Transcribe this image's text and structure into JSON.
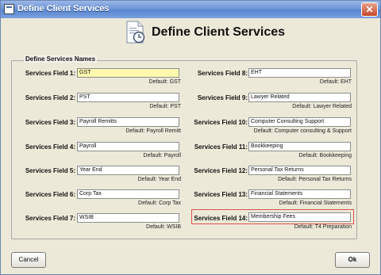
{
  "window": {
    "title": "Define Client Services",
    "close_glyph": "✕"
  },
  "header": {
    "title": "Define Client Services",
    "icon": "document-clock-icon"
  },
  "group": {
    "label": "Define Services Names"
  },
  "fields": [
    {
      "label": "Services Field 1:",
      "value": "GST",
      "default": "Default: GST"
    },
    {
      "label": "Services Field 2:",
      "value": "PST",
      "default": "Default: PST"
    },
    {
      "label": "Services Field 3:",
      "value": "Payroll Remitts",
      "default": "Default: Payroll Remitt"
    },
    {
      "label": "Services Field 4:",
      "value": "Payroll",
      "default": "Default: Payroll"
    },
    {
      "label": "Services Field 5:",
      "value": "Year End",
      "default": "Default: Year End"
    },
    {
      "label": "Services Field 6:",
      "value": "Corp Tax",
      "default": "Default: Corp Tax"
    },
    {
      "label": "Services Field 7:",
      "value": "WSIB",
      "default": "Default: WSIB"
    },
    {
      "label": "Services Field 8:",
      "value": "EHT",
      "default": "Default: EHT"
    },
    {
      "label": "Services Field 9:",
      "value": "Lawyer Related",
      "default": "Default: Lawyer Related"
    },
    {
      "label": "Services Field 10:",
      "value": "Computer Consulting Support",
      "default": "Default: Computer consulting & Support"
    },
    {
      "label": "Services Field 11:",
      "value": "Bookkeeping",
      "default": "Default: Bookkeeping"
    },
    {
      "label": "Services Field 12:",
      "value": "Personal Tax Returns",
      "default": "Default: Personal Tax Returns"
    },
    {
      "label": "Services Field 13:",
      "value": "Financial Statements",
      "default": "Default: Financial Statements"
    },
    {
      "label": "Services Field 14:",
      "value": "Membership Fees",
      "default": "Default: T4 Preparation"
    }
  ],
  "buttons": {
    "cancel": "Cancel",
    "ok": "Ok"
  },
  "colors": {
    "focused_input": "#fff9b0",
    "highlight_border": "#d9534f"
  }
}
